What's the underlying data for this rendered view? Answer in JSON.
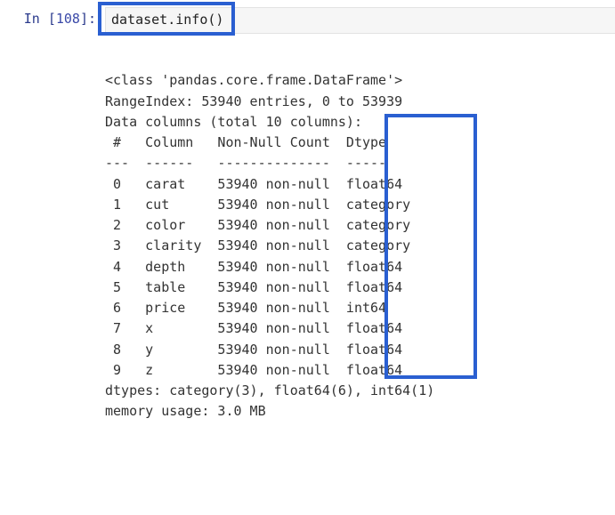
{
  "cell": {
    "prompt_label": "In ",
    "exec_count": "108",
    "code": "dataset.info()"
  },
  "output": {
    "class_line": "<class 'pandas.core.frame.DataFrame'>",
    "rangeindex_line": "RangeIndex: 53940 entries, 0 to 53939",
    "datacolumns_line": "Data columns (total 10 columns):",
    "header_line": " #   Column   Non-Null Count  Dtype   ",
    "sep_line": "---  ------   --------------  -----   ",
    "columns": [
      {
        "idx": "0",
        "name": "carat",
        "nn": "53940 non-null",
        "dtype": "float64"
      },
      {
        "idx": "1",
        "name": "cut",
        "nn": "53940 non-null",
        "dtype": "category"
      },
      {
        "idx": "2",
        "name": "color",
        "nn": "53940 non-null",
        "dtype": "category"
      },
      {
        "idx": "3",
        "name": "clarity",
        "nn": "53940 non-null",
        "dtype": "category"
      },
      {
        "idx": "4",
        "name": "depth",
        "nn": "53940 non-null",
        "dtype": "float64"
      },
      {
        "idx": "5",
        "name": "table",
        "nn": "53940 non-null",
        "dtype": "float64"
      },
      {
        "idx": "6",
        "name": "price",
        "nn": "53940 non-null",
        "dtype": "int64"
      },
      {
        "idx": "7",
        "name": "x",
        "nn": "53940 non-null",
        "dtype": "float64"
      },
      {
        "idx": "8",
        "name": "y",
        "nn": "53940 non-null",
        "dtype": "float64"
      },
      {
        "idx": "9",
        "name": "z",
        "nn": "53940 non-null",
        "dtype": "float64"
      }
    ],
    "dtypes_line": "dtypes: category(3), float64(6), int64(1)",
    "memory_line": "memory usage: 3.0 MB"
  }
}
